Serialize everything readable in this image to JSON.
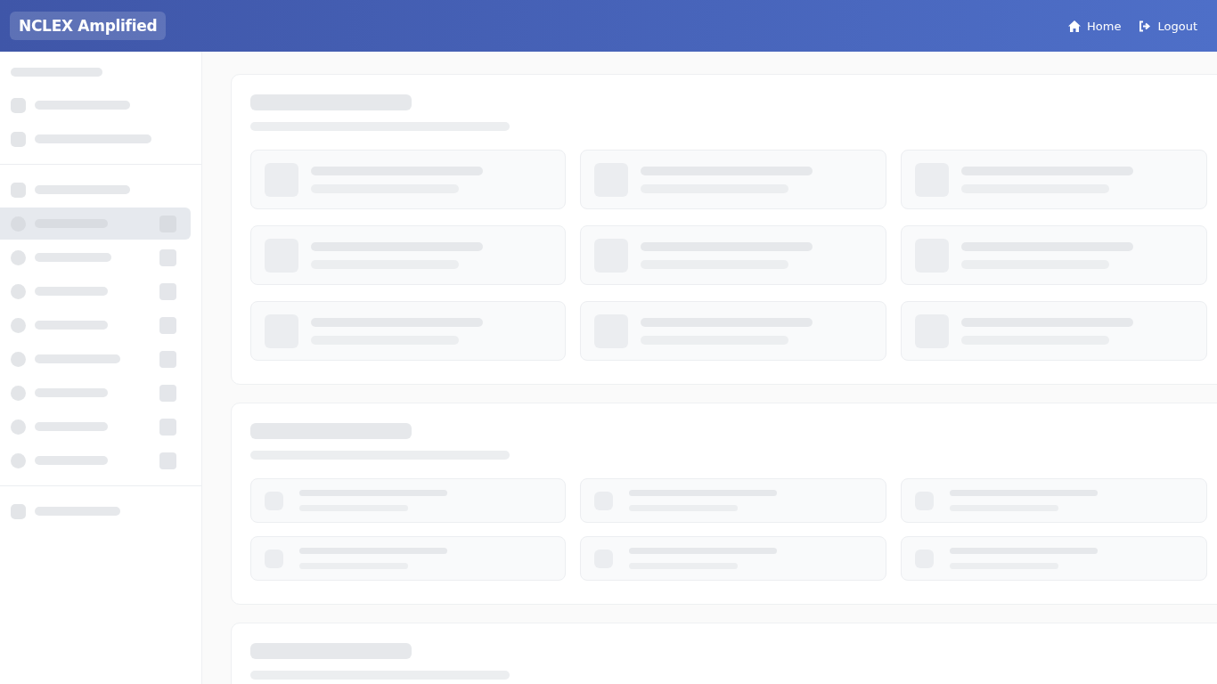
{
  "header": {
    "brand": "NCLEX Amplified",
    "links": [
      {
        "kind": "home",
        "label": "Home"
      },
      {
        "kind": "logout",
        "label": "Logout"
      }
    ]
  },
  "sidebar": {
    "groups": [
      {
        "kind": "headed",
        "items": [
          {
            "kind": "plain",
            "selected": false
          },
          {
            "kind": "plain",
            "selected": false
          }
        ]
      },
      {
        "kind": "plain",
        "items": [
          {
            "kind": "plain",
            "selected": false
          },
          {
            "kind": "badge",
            "selected": true
          },
          {
            "kind": "badge",
            "selected": false
          },
          {
            "kind": "badge",
            "selected": false
          },
          {
            "kind": "badge",
            "selected": false
          },
          {
            "kind": "badge",
            "selected": false
          },
          {
            "kind": "badge",
            "selected": false
          },
          {
            "kind": "badge",
            "selected": false
          },
          {
            "kind": "badge",
            "selected": false
          }
        ]
      },
      {
        "kind": "plain",
        "items": [
          {
            "kind": "plain",
            "selected": false
          }
        ]
      }
    ]
  },
  "sections": [
    {
      "kind": "large",
      "cards": [
        {
          "kind": "tile"
        },
        {
          "kind": "tile"
        },
        {
          "kind": "tile"
        },
        {
          "kind": "tile"
        },
        {
          "kind": "tile"
        },
        {
          "kind": "tile"
        },
        {
          "kind": "tile"
        },
        {
          "kind": "tile"
        },
        {
          "kind": "tile"
        }
      ]
    },
    {
      "kind": "small",
      "cards": [
        {
          "kind": "tile"
        },
        {
          "kind": "tile"
        },
        {
          "kind": "tile"
        },
        {
          "kind": "tile"
        },
        {
          "kind": "tile"
        },
        {
          "kind": "tile"
        }
      ]
    },
    {
      "kind": "large"
    }
  ]
}
